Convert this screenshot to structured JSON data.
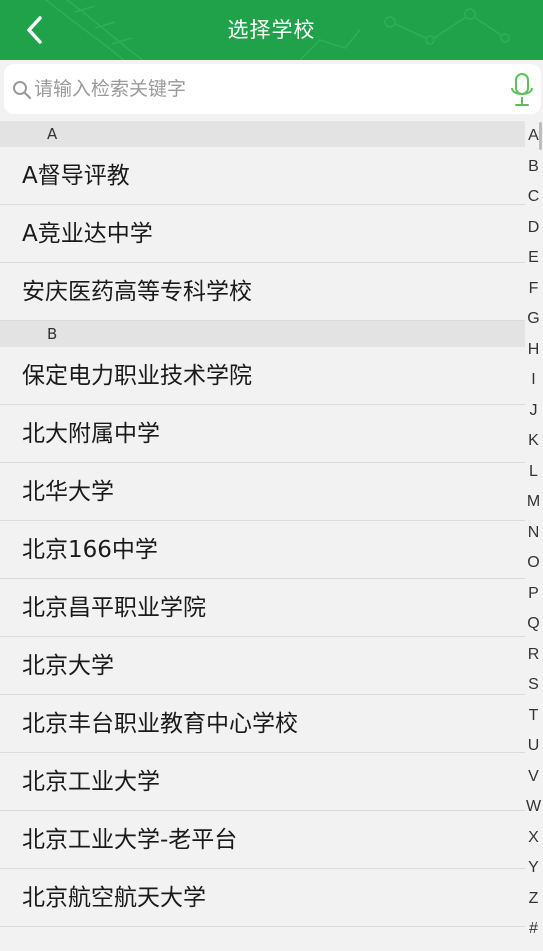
{
  "header": {
    "title": "选择学校",
    "back_icon": "back-chevron-icon"
  },
  "search": {
    "placeholder": "请输入检索关键字",
    "value": "",
    "search_icon": "magnifier-icon",
    "voice_icon": "microphone-icon"
  },
  "colors": {
    "header_bg": "#1fa24a",
    "mic_green": "#5cc15c",
    "row_bg": "#f2f2f2",
    "section_bg": "#e3e3e3"
  },
  "sections": [
    {
      "letter": "A",
      "items": [
        "A督导评教",
        "A竞业达中学",
        "安庆医药高等专科学校"
      ]
    },
    {
      "letter": "B",
      "items": [
        "保定电力职业技术学院",
        "北大附属中学",
        "北华大学",
        "北京166中学",
        "北京昌平职业学院",
        "北京大学",
        "北京丰台职业教育中心学校",
        "北京工业大学",
        "北京工业大学-老平台",
        "北京航空航天大学"
      ]
    }
  ],
  "index_letters": [
    "A",
    "B",
    "C",
    "D",
    "E",
    "F",
    "G",
    "H",
    "I",
    "J",
    "K",
    "L",
    "M",
    "N",
    "O",
    "P",
    "Q",
    "R",
    "S",
    "T",
    "U",
    "V",
    "W",
    "X",
    "Y",
    "Z",
    "#"
  ]
}
